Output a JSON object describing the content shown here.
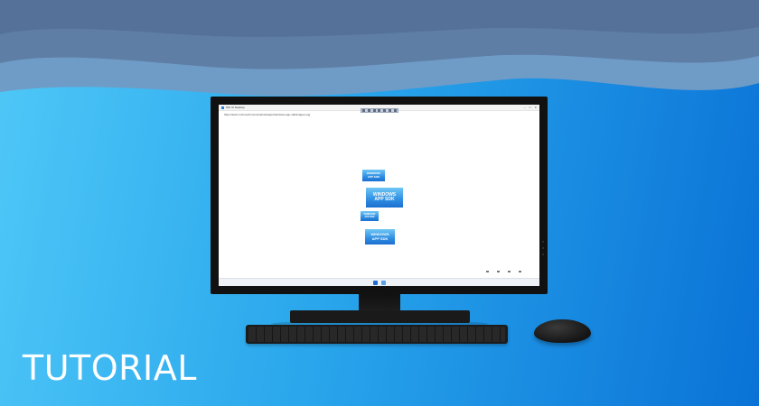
{
  "app": {
    "title": "Win UI Desktop",
    "url": "https://learn.microsoft.com/windows/apps/windows-app-sdk/images.png",
    "window_controls": [
      "–",
      "□",
      "✕"
    ]
  },
  "banners": [
    {
      "line1": "WINDOWS",
      "line2": "APP SDK"
    },
    {
      "line1": "WINDOWS",
      "line2": "APP SDK"
    },
    {
      "line1": "WINDOWS",
      "line2": "APP SDK"
    },
    {
      "line1": "WINDOWS",
      "line2": "APP SDK"
    }
  ],
  "icons": {
    "toolbar": [
      "save-icon",
      "text-icon",
      "rotate-icon",
      "edit-icon",
      "bookmark-icon",
      "crop-icon",
      "close-icon"
    ],
    "taskbar": [
      "start-icon",
      "app-icon"
    ]
  },
  "headline": "TUTORIAL",
  "colors": {
    "accent": "#1c6fd1",
    "background_start": "#4fc8f7",
    "background_end": "#0a72d6"
  }
}
